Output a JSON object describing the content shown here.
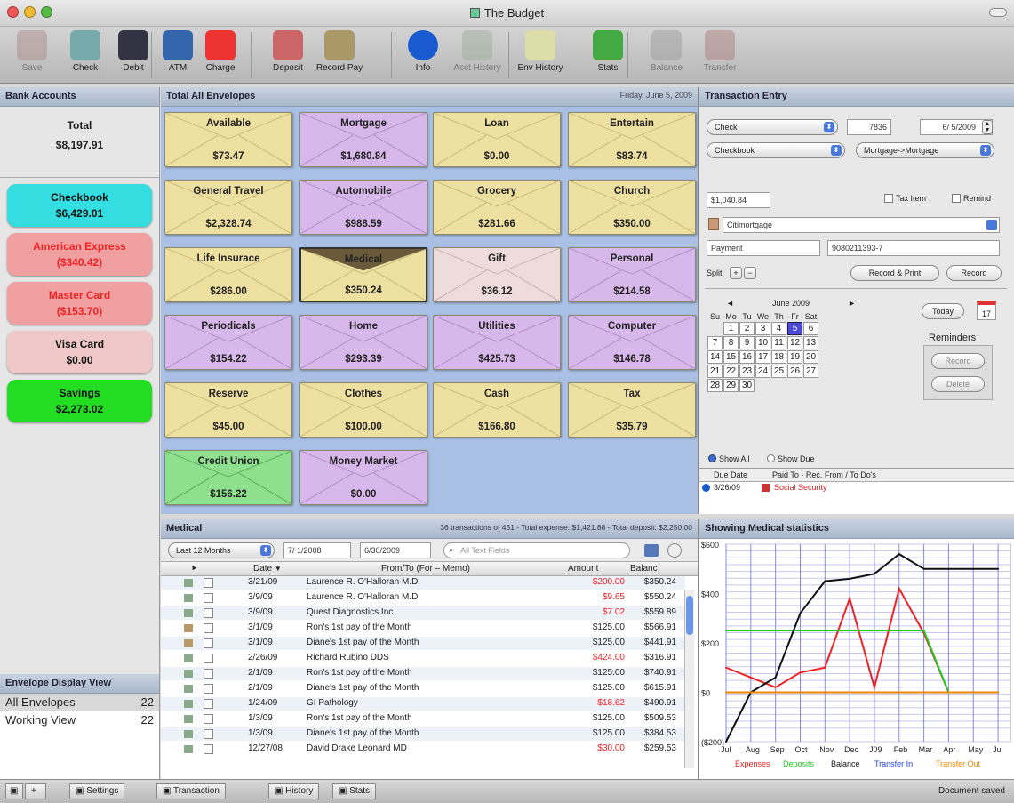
{
  "window": {
    "title": "The Budget"
  },
  "toolbar": [
    {
      "label": "Save",
      "icon": "save-icon",
      "enabled": false
    },
    {
      "label": "Check",
      "icon": "check-icon",
      "enabled": true
    },
    {
      "label": "Debit",
      "icon": "debit-icon",
      "enabled": true
    },
    {
      "label": "ATM",
      "icon": "atm-icon",
      "enabled": true
    },
    {
      "label": "Charge",
      "icon": "charge-icon",
      "enabled": true
    },
    {
      "label": "Deposit",
      "icon": "deposit-icon",
      "enabled": true
    },
    {
      "label": "Record Pay",
      "icon": "record-pay-icon",
      "enabled": true
    },
    {
      "label": "Info",
      "icon": "info-icon",
      "enabled": true
    },
    {
      "label": "Acct History",
      "icon": "acct-history-icon",
      "enabled": false
    },
    {
      "label": "Env History",
      "icon": "env-history-icon",
      "enabled": true
    },
    {
      "label": "Stats",
      "icon": "stats-icon",
      "enabled": true
    },
    {
      "label": "Balance",
      "icon": "balance-icon",
      "enabled": false
    },
    {
      "label": "Transfer",
      "icon": "transfer-icon",
      "enabled": false
    }
  ],
  "bank": {
    "header": "Bank Accounts",
    "total_label": "Total",
    "total_value": "$8,197.91",
    "accounts": [
      {
        "name": "Checkbook",
        "value": "$6,429.01",
        "bg": "#33dde0",
        "fg": "#111"
      },
      {
        "name": "American Express",
        "value": "($340.42)",
        "bg": "#f0a0a0",
        "fg": "#ee2222"
      },
      {
        "name": "Master Card",
        "value": "($153.70)",
        "bg": "#f0a0a0",
        "fg": "#ee2222"
      },
      {
        "name": "Visa Card",
        "value": "$0.00",
        "bg": "#f0c8c8",
        "fg": "#111"
      },
      {
        "name": "Savings",
        "value": "$2,273.02",
        "bg": "#22dd22",
        "fg": "#111"
      }
    ]
  },
  "envelope_view": {
    "header": "Envelope Display View",
    "rows": [
      {
        "name": "All Envelopes",
        "count": "22"
      },
      {
        "name": "Working View",
        "count": "22"
      }
    ]
  },
  "envelopes": {
    "header": "Total All Envelopes",
    "date": "Friday, June 5, 2009",
    "items": [
      {
        "name": "Available",
        "amount": "$73.47",
        "color": "yel"
      },
      {
        "name": "Mortgage",
        "amount": "$1,680.84",
        "color": "pur"
      },
      {
        "name": "Loan",
        "amount": "$0.00",
        "color": "yel"
      },
      {
        "name": "Entertain",
        "amount": "$83.74",
        "color": "yel"
      },
      {
        "name": "General Travel",
        "amount": "$2,328.74",
        "color": "yel"
      },
      {
        "name": "Automobile",
        "amount": "$988.59",
        "color": "pur"
      },
      {
        "name": "Grocery",
        "amount": "$281.66",
        "color": "yel"
      },
      {
        "name": "Church",
        "amount": "$350.00",
        "color": "yel"
      },
      {
        "name": "Life Insurace",
        "amount": "$286.00",
        "color": "yel"
      },
      {
        "name": "Medical",
        "amount": "$350.24",
        "color": "yel"
      },
      {
        "name": "Gift",
        "amount": "$36.12",
        "color": "pnk"
      },
      {
        "name": "Personal",
        "amount": "$214.58",
        "color": "pur"
      },
      {
        "name": "Periodicals",
        "amount": "$154.22",
        "color": "pur"
      },
      {
        "name": "Home",
        "amount": "$293.39",
        "color": "pur"
      },
      {
        "name": "Utilities",
        "amount": "$425.73",
        "color": "pur"
      },
      {
        "name": "Computer",
        "amount": "$146.78",
        "color": "pur"
      },
      {
        "name": "Reserve",
        "amount": "$45.00",
        "color": "yel"
      },
      {
        "name": "Clothes",
        "amount": "$100.00",
        "color": "yel"
      },
      {
        "name": "Cash",
        "amount": "$166.80",
        "color": "yel"
      },
      {
        "name": "Tax",
        "amount": "$35.79",
        "color": "yel"
      },
      {
        "name": "Credit Union",
        "amount": "$156.22",
        "color": "grn"
      },
      {
        "name": "Money Market",
        "amount": "$0.00",
        "color": "pur"
      }
    ]
  },
  "entry": {
    "header": "Transaction Entry",
    "type": "Check",
    "number": "7836",
    "date": "6/ 5/2009",
    "account": "Checkbook",
    "envelope": "Mortgage->Mortgage",
    "amount": "$1,040.84",
    "tax_item": "Tax Item",
    "remind": "Remind",
    "payee": "Citimortgage",
    "memo": "Payment",
    "ref": "9080211393-7",
    "split_label": "Split:",
    "split_plus": "+",
    "split_minus": "−",
    "record_print": "Record & Print",
    "record": "Record",
    "today": "Today",
    "cal_icon_text": "17",
    "cal_prev": "◄",
    "cal_next": "►",
    "month": "June 2009",
    "days": [
      "Su",
      "Mo",
      "Tu",
      "We",
      "Th",
      "Fr",
      "Sat"
    ],
    "weeks": [
      [
        "",
        "1",
        "2",
        "3",
        "4",
        "5",
        "6"
      ],
      [
        "7",
        "8",
        "9",
        "10",
        "11",
        "12",
        "13"
      ],
      [
        "14",
        "15",
        "16",
        "17",
        "18",
        "19",
        "20"
      ],
      [
        "21",
        "22",
        "23",
        "24",
        "25",
        "26",
        "27"
      ],
      [
        "28",
        "29",
        "30",
        "",
        "",
        "",
        ""
      ]
    ],
    "reminders_label": "Reminders",
    "rem_record": "Record",
    "rem_delete": "Delete",
    "show_all": "Show All",
    "show_due": "Show Due",
    "due_col1": "Due Date",
    "due_col2": "Paid To - Rec. From / To Do's",
    "due_rows": [
      {
        "date": "3/26/09",
        "text": "Social Security"
      }
    ]
  },
  "list": {
    "header": "Medical",
    "summary": "36 transactions of 451 - Total expense: $1,421.88 - Total deposit: $2,250.00",
    "range": "Last 12 Months",
    "from": "7/ 1/2008",
    "to": "6/30/2009",
    "search_placeholder": "All Text Fields",
    "columns": [
      "Date",
      "From/To  (For – Memo)",
      "Amount",
      "Balanc"
    ],
    "sort_marker": "▼",
    "rows": [
      {
        "date": "3/21/09",
        "who": "Laurence R. O'Halloran M.D.",
        "amount": "$200.00",
        "bal": "$350.24",
        "neg": true
      },
      {
        "date": "3/9/09",
        "who": "Laurence R. O'Halloran M.D.",
        "amount": "$9.65",
        "bal": "$550.24",
        "neg": true
      },
      {
        "date": "3/9/09",
        "who": "Quest Diagnostics Inc.",
        "amount": "$7.02",
        "bal": "$559.89",
        "neg": true
      },
      {
        "date": "3/1/09",
        "who": "Ron's 1st pay of the Month",
        "amount": "$125.00",
        "bal": "$566.91",
        "neg": false
      },
      {
        "date": "3/1/09",
        "who": "Diane's 1st pay of the Month",
        "amount": "$125.00",
        "bal": "$441.91",
        "neg": false
      },
      {
        "date": "2/26/09",
        "who": "Richard Rubino DDS",
        "amount": "$424.00",
        "bal": "$316.91",
        "neg": true
      },
      {
        "date": "2/1/09",
        "who": "Ron's 1st pay of the Month",
        "amount": "$125.00",
        "bal": "$740.91",
        "neg": false
      },
      {
        "date": "2/1/09",
        "who": "Diane's 1st pay of the Month",
        "amount": "$125.00",
        "bal": "$615.91",
        "neg": false
      },
      {
        "date": "1/24/09",
        "who": "GI Pathology",
        "amount": "$18.62",
        "bal": "$490.91",
        "neg": true
      },
      {
        "date": "1/3/09",
        "who": "Ron's 1st pay of the Month",
        "amount": "$125.00",
        "bal": "$509.53",
        "neg": false
      },
      {
        "date": "1/3/09",
        "who": "Diane's 1st pay of the Month",
        "amount": "$125.00",
        "bal": "$384.53",
        "neg": false
      },
      {
        "date": "12/27/08",
        "who": "David Drake Leonard MD",
        "amount": "$30.00",
        "bal": "$259.53",
        "neg": true
      }
    ]
  },
  "stats": {
    "header": "Showing Medical statistics",
    "legend": [
      {
        "label": "Expenses",
        "color": "#ee2222"
      },
      {
        "label": "Deposits",
        "color": "#22cc22"
      },
      {
        "label": "Balance",
        "color": "#111111"
      },
      {
        "label": "Transfer In",
        "color": "#2244ee"
      },
      {
        "label": "Transfer Out",
        "color": "#ee8800"
      }
    ]
  },
  "chart_data": {
    "type": "line",
    "categories": [
      "Jul",
      "Aug",
      "Sep",
      "Oct",
      "Nov",
      "Dec",
      "J09",
      "Feb",
      "Mar",
      "Apr",
      "May",
      "Ju"
    ],
    "ylim": [
      -200,
      600
    ],
    "yticks": [
      "$600",
      "$400",
      "$200",
      "$0",
      "($200)"
    ],
    "series": [
      {
        "name": "Expenses",
        "color": "#ee2222",
        "values": [
          100,
          60,
          20,
          80,
          100,
          380,
          20,
          420,
          240,
          0,
          0,
          0
        ]
      },
      {
        "name": "Deposits",
        "color": "#22cc22",
        "values": [
          250,
          250,
          250,
          250,
          250,
          250,
          250,
          250,
          250,
          0,
          0,
          0
        ]
      },
      {
        "name": "Balance",
        "color": "#111111",
        "values": [
          -200,
          0,
          60,
          320,
          450,
          460,
          480,
          560,
          500,
          500,
          500,
          500
        ]
      },
      {
        "name": "Transfer Out",
        "color": "#ee8800",
        "values": [
          0,
          0,
          0,
          0,
          0,
          0,
          0,
          0,
          0,
          0,
          0,
          0
        ]
      }
    ]
  },
  "statusbar": {
    "buttons": [
      "Settings",
      "Transaction",
      "History",
      "Stats"
    ],
    "status": "Document saved"
  }
}
